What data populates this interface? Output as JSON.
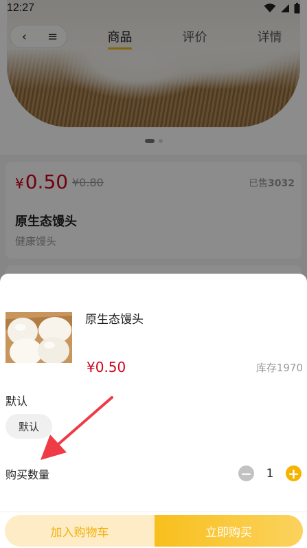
{
  "status_bar": {
    "time": "12:27"
  },
  "nav": {
    "back_glyph": "‹",
    "menu_glyph": "≡",
    "tabs": [
      {
        "label": "商品",
        "active": true
      },
      {
        "label": "评价",
        "active": false
      },
      {
        "label": "详情",
        "active": false
      }
    ]
  },
  "product": {
    "currency": "¥",
    "price": "0.50",
    "original_price": "¥0.80",
    "sold_label": "已售",
    "sold_count": "3032",
    "name": "原生态馒头",
    "subtitle": "健康馒头"
  },
  "sku_sheet": {
    "name": "原生态馒头",
    "price": "¥0.50",
    "stock": "库存1970",
    "spec_title": "默认",
    "spec_options": [
      "默认"
    ],
    "quantity_title": "购买数量",
    "quantity": "1",
    "minus_glyph": "−",
    "plus_glyph": "+"
  },
  "actions": {
    "add_to_cart": "加入购物车",
    "buy_now": "立即购买"
  },
  "colors": {
    "accent": "#f5b400",
    "price_red": "#d0021b",
    "annotation_arrow": "#ee3b45"
  }
}
